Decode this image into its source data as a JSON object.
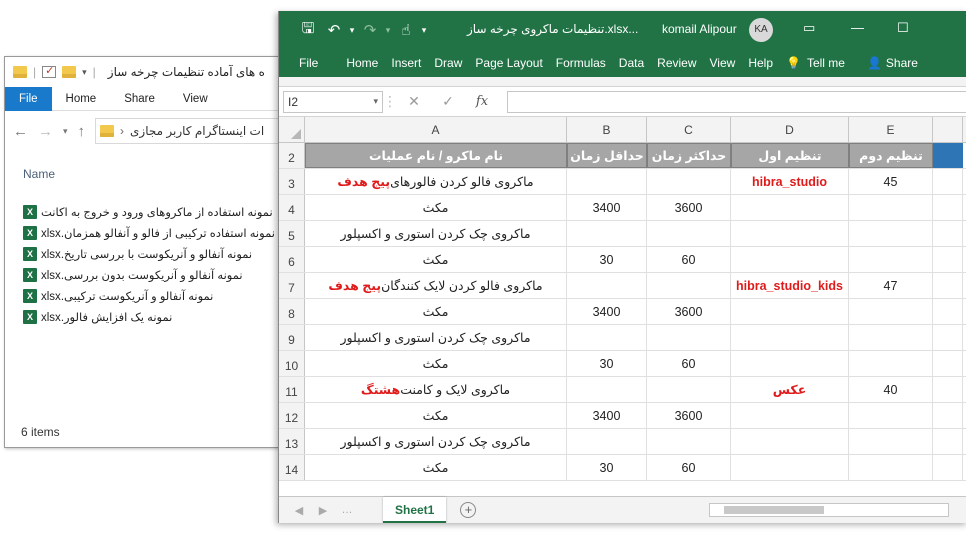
{
  "explorer": {
    "title": "ه های آماده تنظیمات چرخه ساز",
    "ribbon_tabs": [
      "File",
      "Home",
      "Share",
      "View"
    ],
    "address": "ات اینستاگرام کاربر مجازی",
    "column_header": "Name",
    "files": [
      "نمونه استفاده از ماکروهای ورود و خروج به اکانت",
      "نمونه استفاده ترکیبی از فالو و آنفالو همزمان.xlsx",
      "نمونه آنفالو و آنریکوست با بررسی تاریخ.xlsx",
      "نمونه آنفالو و آنریکوست بدون بررسی.xlsx",
      "نمونه آنفالو و آنریکوست ترکیبی.xlsx",
      "نمونه یک افزایش فالور.xlsx"
    ],
    "status": "6 items"
  },
  "excel": {
    "title": "تنظیمات ماکروی چرخه ساز.xlsx...",
    "user": "komail Alipour",
    "avatar": "KA",
    "ribbon_tabs": [
      "File",
      "Home",
      "Insert",
      "Draw",
      "Page Layout",
      "Formulas",
      "Data",
      "Review",
      "View",
      "Help",
      "Tell me",
      "Share"
    ],
    "name_box": "I2",
    "columns": [
      "A",
      "B",
      "C",
      "D",
      "E"
    ],
    "header_row": {
      "num": "2",
      "A": "نام ماکرو / نام عملیات",
      "B": "حداقل زمان",
      "C": "حداکثر زمان",
      "D": "تنظیم اول",
      "E": "تنظیم دوم"
    },
    "rows": [
      {
        "num": "3",
        "A_text": "ماکروی فالو کردن فالورهای ",
        "A_red": "پیج هدف",
        "B": "",
        "C": "",
        "D": "hibra_studio",
        "E": "45"
      },
      {
        "num": "4",
        "A_text": "مکث",
        "A_red": "",
        "B": "3400",
        "C": "3600",
        "D": "",
        "E": ""
      },
      {
        "num": "5",
        "A_text": "ماکروی چک کردن استوری و اکسپلور",
        "A_red": "",
        "B": "",
        "C": "",
        "D": "",
        "E": ""
      },
      {
        "num": "6",
        "A_text": "مکث",
        "A_red": "",
        "B": "30",
        "C": "60",
        "D": "",
        "E": ""
      },
      {
        "num": "7",
        "A_text": "ماکروی فالو کردن لایک کنندگان ",
        "A_red": "پیج هدف",
        "B": "",
        "C": "",
        "D": "hibra_studio_kids",
        "E": "47"
      },
      {
        "num": "8",
        "A_text": "مکث",
        "A_red": "",
        "B": "3400",
        "C": "3600",
        "D": "",
        "E": ""
      },
      {
        "num": "9",
        "A_text": "ماکروی چک کردن استوری و اکسپلور",
        "A_red": "",
        "B": "",
        "C": "",
        "D": "",
        "E": ""
      },
      {
        "num": "10",
        "A_text": "مکث",
        "A_red": "",
        "B": "30",
        "C": "60",
        "D": "",
        "E": ""
      },
      {
        "num": "11",
        "A_text": "ماکروی لایک و کامنت ",
        "A_red": "هشتگ",
        "B": "",
        "C": "",
        "D": "عکس",
        "E": "40"
      },
      {
        "num": "12",
        "A_text": "مکث",
        "A_red": "",
        "B": "3400",
        "C": "3600",
        "D": "",
        "E": ""
      },
      {
        "num": "13",
        "A_text": "ماکروی چک کردن استوری و اکسپلور",
        "A_red": "",
        "B": "",
        "C": "",
        "D": "",
        "E": ""
      },
      {
        "num": "14",
        "A_text": "مکث",
        "A_red": "",
        "B": "30",
        "C": "60",
        "D": "",
        "E": ""
      }
    ],
    "sheet_tab": "Sheet1"
  }
}
